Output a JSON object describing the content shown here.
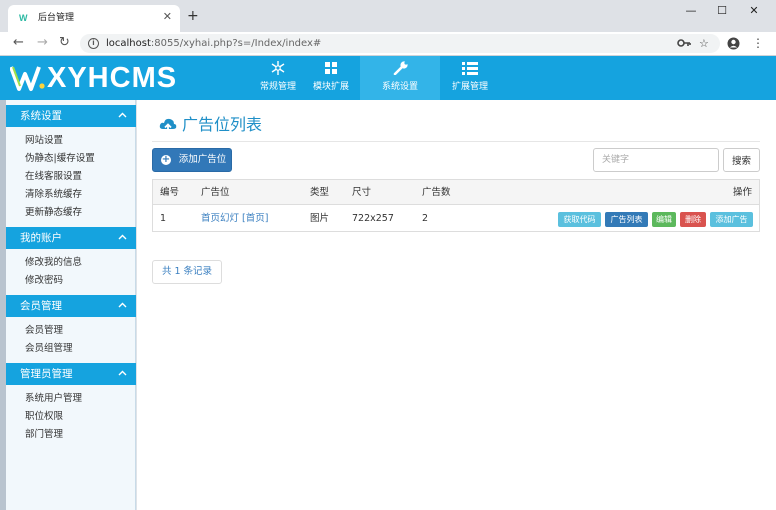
{
  "browser": {
    "tab_title": "后台管理",
    "tab_favicon": "W",
    "url_host": "localhost",
    "url_rest": ":8055/xyhai.php?s=/Index/index#"
  },
  "header": {
    "logo_text": "XYHCMS",
    "nav": [
      {
        "label": "常规管理",
        "icon": "snowflake-icon"
      },
      {
        "label": "模块扩展",
        "icon": "grid-icon"
      },
      {
        "label": "系统设置",
        "icon": "wrench-icon",
        "active": true
      },
      {
        "label": "扩展管理",
        "icon": "list-icon"
      }
    ]
  },
  "sidebar": {
    "groups": [
      {
        "title": "系统设置",
        "items": [
          "网站设置",
          "伪静态|缓存设置",
          "在线客服设置",
          "清除系统缓存",
          "更新静态缓存"
        ]
      },
      {
        "title": "我的账户",
        "items": [
          "修改我的信息",
          "修改密码"
        ]
      },
      {
        "title": "会员管理",
        "items": [
          "会员管理",
          "会员组管理"
        ]
      },
      {
        "title": "管理员管理",
        "items": [
          "系统用户管理",
          "职位权限",
          "部门管理"
        ]
      }
    ]
  },
  "main": {
    "title": "广告位列表",
    "add_button": "添加广告位",
    "search_placeholder": "关键字",
    "search_button": "搜索",
    "columns": [
      "编号",
      "广告位",
      "类型",
      "尺寸",
      "广告数",
      "操作"
    ],
    "rows": [
      {
        "id": "1",
        "name": "首页幻灯 [首页]",
        "type": "图片",
        "size": "722x257",
        "count": "2"
      }
    ],
    "actions": [
      {
        "label": "获取代码",
        "color": "#5bc0de"
      },
      {
        "label": "广告列表",
        "color": "#337ab7"
      },
      {
        "label": "编辑",
        "color": "#5cb85c"
      },
      {
        "label": "删除",
        "color": "#d9534f"
      },
      {
        "label": "添加广告",
        "color": "#5bc0de"
      }
    ],
    "pager": "共 1 条记录"
  },
  "colors": {
    "brand": "#15a3df",
    "link": "#3a7fc0"
  }
}
